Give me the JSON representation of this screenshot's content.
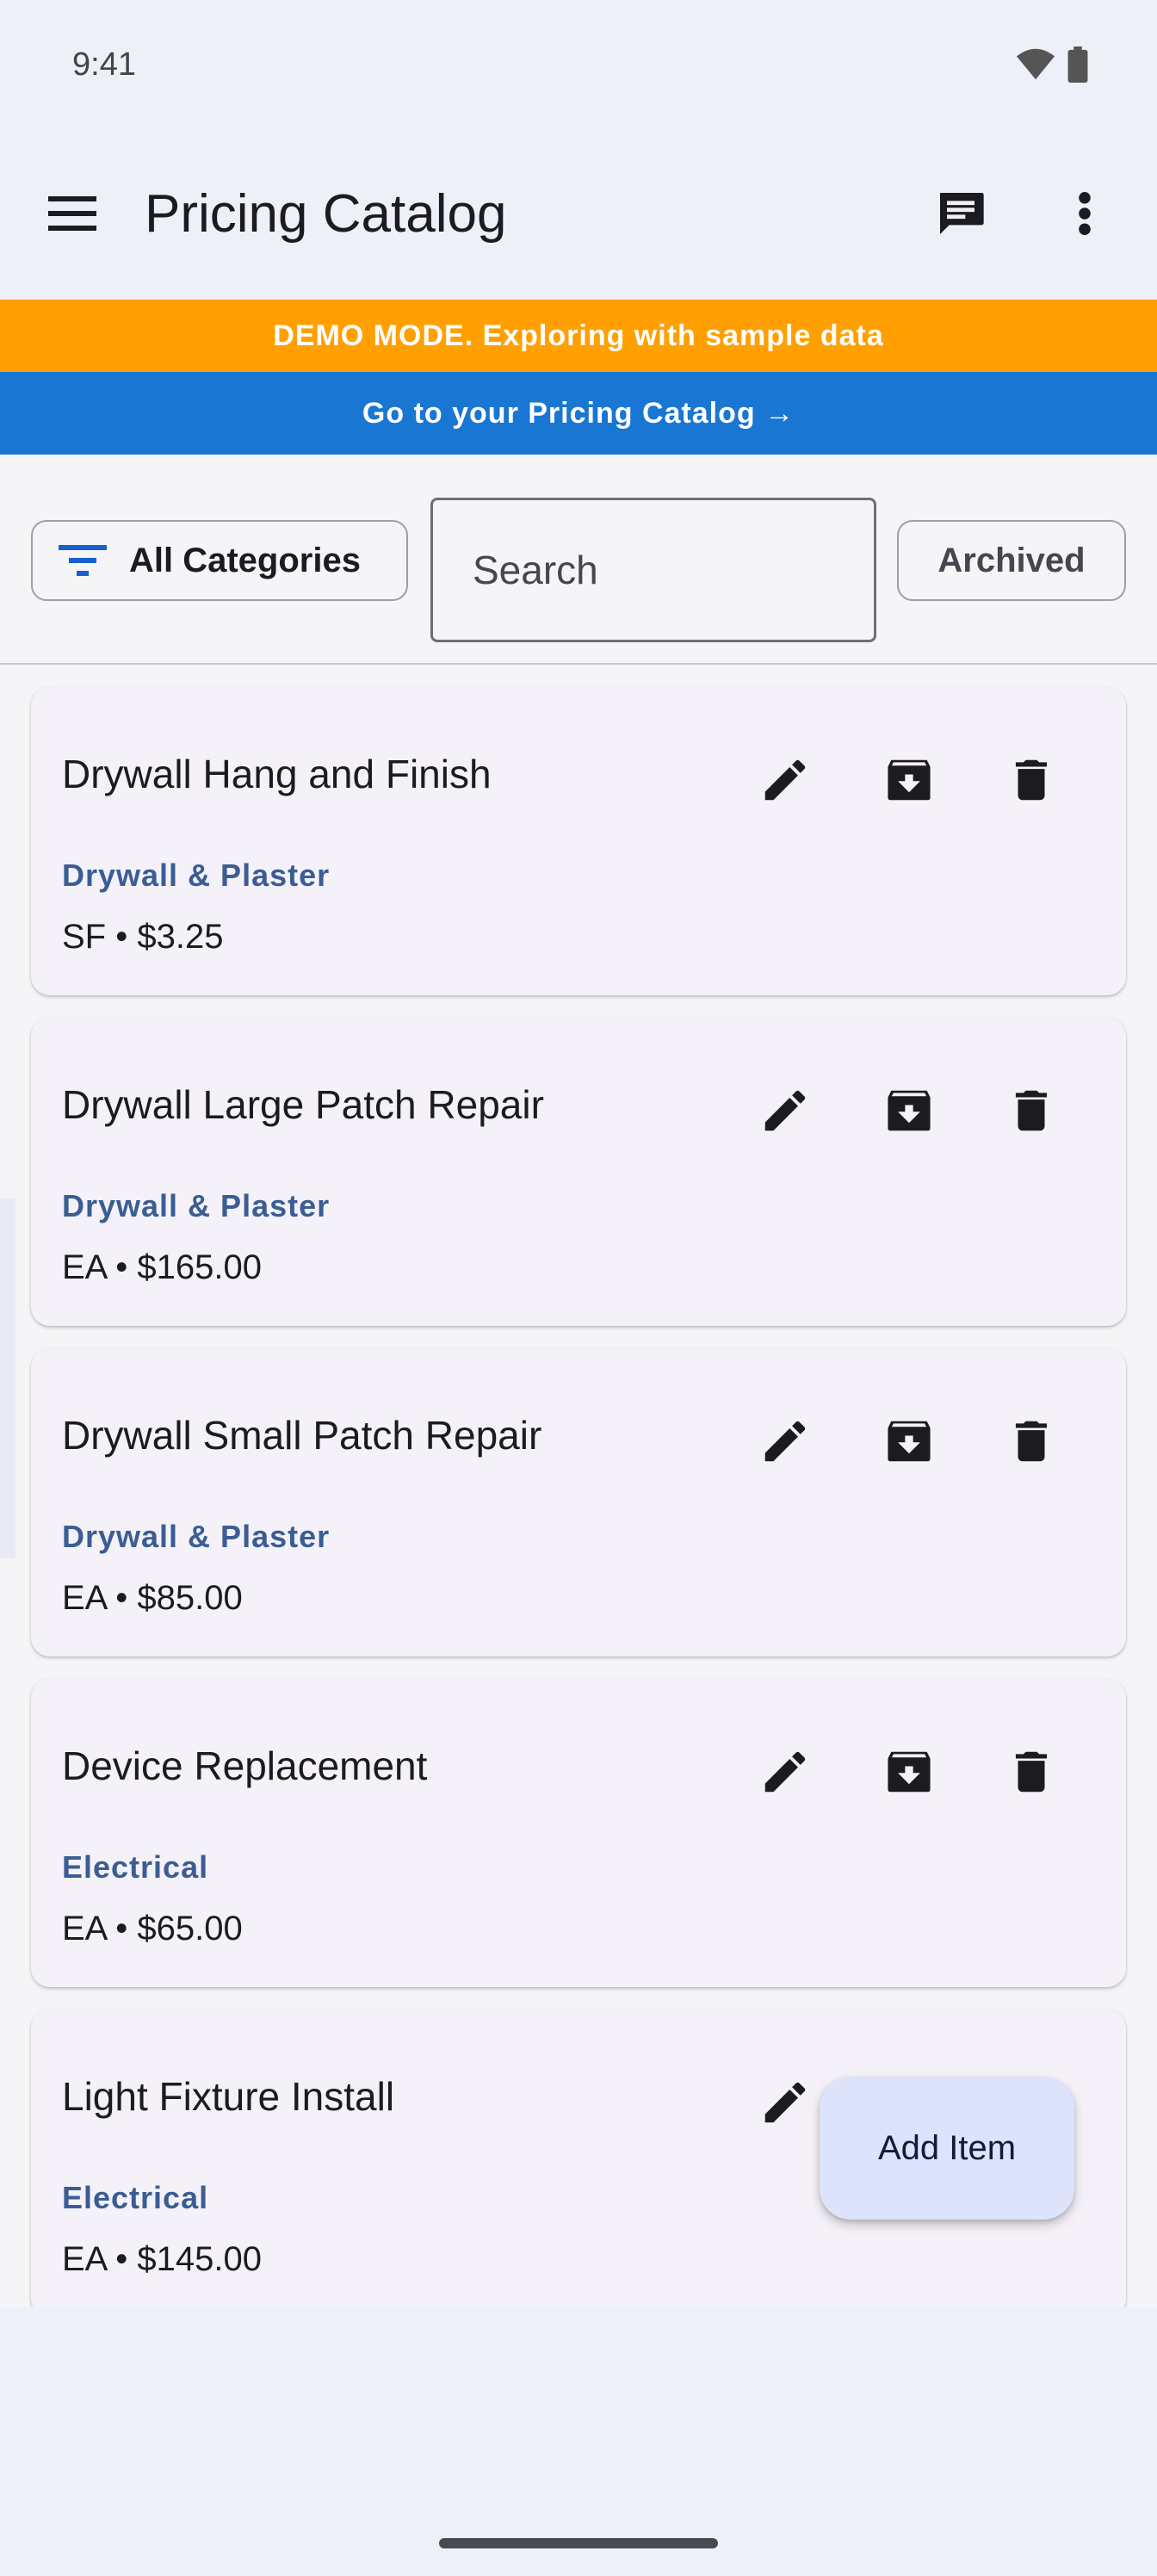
{
  "status_bar": {
    "time": "9:41"
  },
  "app_bar": {
    "title": "Pricing Catalog",
    "menu_icon": "menu-icon",
    "chat_icon": "chat-icon",
    "more_icon": "more-vert-icon"
  },
  "banners": {
    "demo": "DEMO MODE. Exploring with sample data",
    "goto": "Go to your Pricing Catalog →"
  },
  "filters": {
    "category_label": "All Categories",
    "search_placeholder": "Search",
    "search_value": "",
    "archived_label": "Archived"
  },
  "items": [
    {
      "name": "Drywall Hang and Finish",
      "category": "Drywall & Plaster",
      "price_line": "SF • $3.25"
    },
    {
      "name": "Drywall Large Patch Repair",
      "category": "Drywall & Plaster",
      "price_line": "EA • $165.00"
    },
    {
      "name": "Drywall Small Patch Repair",
      "category": "Drywall & Plaster",
      "price_line": "EA • $85.00"
    },
    {
      "name": "Device Replacement",
      "category": "Electrical",
      "price_line": "EA • $65.00"
    },
    {
      "name": "Light Fixture Install",
      "category": "Electrical",
      "price_line": "EA • $145.00"
    }
  ],
  "fab": {
    "label": "Add Item"
  },
  "colors": {
    "demo_banner": "#ffa000",
    "goto_banner": "#1976d2",
    "category_text": "#3a5d94",
    "fab_bg": "#dce3fb"
  }
}
